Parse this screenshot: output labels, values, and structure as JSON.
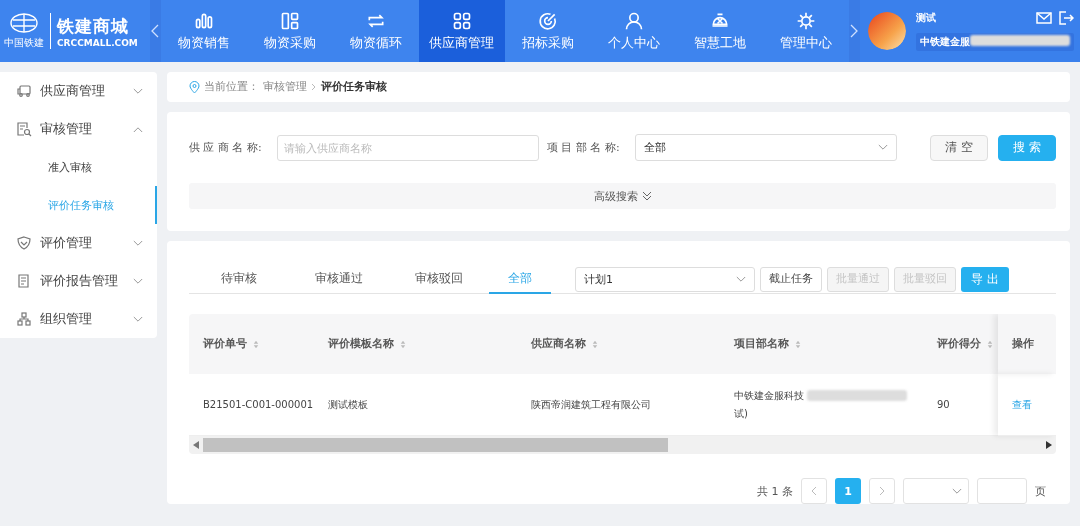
{
  "header": {
    "logo": {
      "group": "中国铁建",
      "name": "铁建商城",
      "domain": "CRCCMALL.COM"
    },
    "nav": [
      {
        "label": "物资销售",
        "selected": false
      },
      {
        "label": "物资采购",
        "selected": false
      },
      {
        "label": "物资循环",
        "selected": false
      },
      {
        "label": "供应商管理",
        "selected": true
      },
      {
        "label": "招标采购",
        "selected": false
      },
      {
        "label": "个人中心",
        "selected": false
      },
      {
        "label": "智慧工地",
        "selected": false
      },
      {
        "label": "管理中心",
        "selected": false
      }
    ],
    "user": {
      "name": "测试",
      "company": "中铁建金服"
    }
  },
  "sidebar": {
    "items": [
      {
        "label": "供应商管理",
        "expanded": false
      },
      {
        "label": "审核管理",
        "expanded": true,
        "children": [
          {
            "label": "准入审核",
            "selected": false
          },
          {
            "label": "评价任务审核",
            "selected": true
          }
        ]
      },
      {
        "label": "评价管理",
        "expanded": false
      },
      {
        "label": "评价报告管理",
        "expanded": false
      },
      {
        "label": "组织管理",
        "expanded": false
      }
    ]
  },
  "breadcrumb": {
    "prefix": "当前位置：",
    "parent": "审核管理",
    "current": "评价任务审核"
  },
  "filters": {
    "supplier": {
      "label": "供 应 商 名 称:",
      "placeholder": "请输入供应商名称"
    },
    "project": {
      "label": "项 目 部 名 称:",
      "value": "全部"
    },
    "clear": "清 空",
    "search": "搜 索",
    "advanced": "高级搜索"
  },
  "tabs": [
    {
      "label": "待审核",
      "selected": false
    },
    {
      "label": "审核通过",
      "selected": false
    },
    {
      "label": "审核驳回",
      "selected": false
    },
    {
      "label": "全部",
      "selected": true
    }
  ],
  "toolbar": {
    "plan": "计划1",
    "buttons": [
      {
        "label": "截止任务",
        "disabled": false
      },
      {
        "label": "批量通过",
        "disabled": true
      },
      {
        "label": "批量驳回",
        "disabled": true
      }
    ],
    "export": "导 出"
  },
  "table": {
    "columns": [
      "评价单号",
      "评价模板名称",
      "供应商名称",
      "项目部名称",
      "评价得分",
      "操作"
    ],
    "rows": [
      {
        "cells": [
          "B21501-C001-000001",
          "测试模板",
          "陕西帝润建筑工程有限公司",
          "中铁建金服科技",
          "90"
        ],
        "project_tail": "试)",
        "action": "查看"
      }
    ]
  },
  "pagination": {
    "total": "共 1 条",
    "pages": [
      {
        "label": "1",
        "selected": true
      }
    ],
    "suffix": "页"
  }
}
